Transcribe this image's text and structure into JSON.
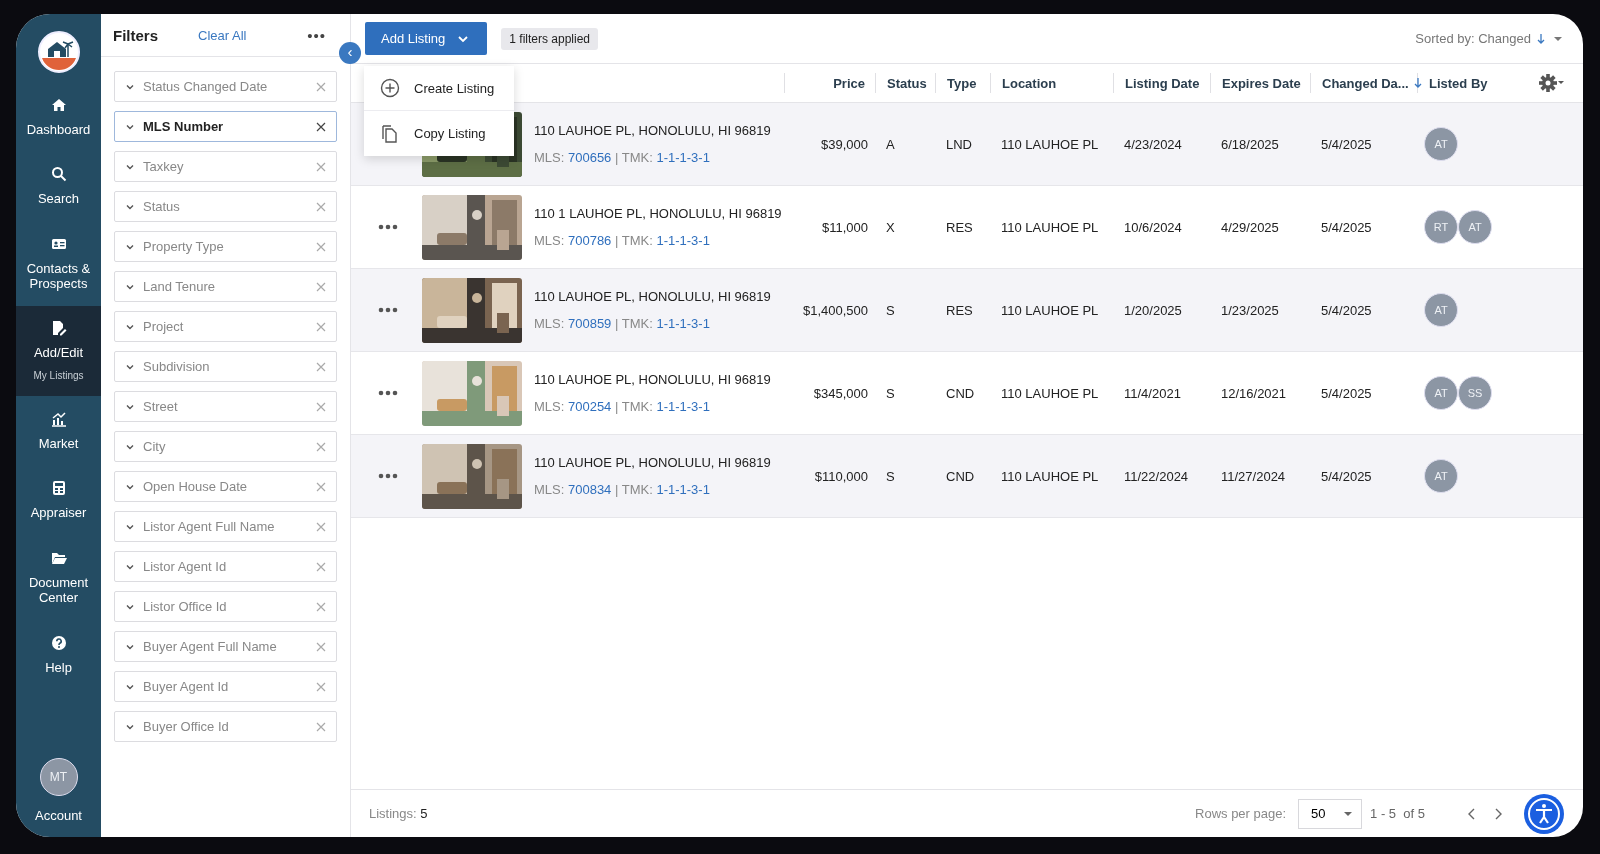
{
  "nav": {
    "items": [
      {
        "label": "Dashboard",
        "selected": false
      },
      {
        "label": "Search",
        "selected": false
      },
      {
        "label": "Contacts & Prospects",
        "selected": false
      },
      {
        "label": "Add/Edit",
        "sublabel": "My Listings",
        "selected": true
      },
      {
        "label": "Market",
        "selected": false
      },
      {
        "label": "Appraiser",
        "selected": false
      },
      {
        "label": "Document Center",
        "selected": false
      },
      {
        "label": "Help",
        "selected": false
      }
    ],
    "account": {
      "initials": "MT",
      "label": "Account"
    }
  },
  "filters": {
    "title": "Filters",
    "clear": "Clear All",
    "more": "•••",
    "collapse": "‹",
    "items": [
      {
        "label": "Status Changed Date",
        "selected": false
      },
      {
        "label": "MLS Number",
        "selected": true
      },
      {
        "label": "Taxkey",
        "selected": false
      },
      {
        "label": "Status",
        "selected": false
      },
      {
        "label": "Property Type",
        "selected": false
      },
      {
        "label": "Land Tenure",
        "selected": false
      },
      {
        "label": "Project",
        "selected": false
      },
      {
        "label": "Subdivision",
        "selected": false
      },
      {
        "label": "Street",
        "selected": false
      },
      {
        "label": "City",
        "selected": false
      },
      {
        "label": "Open House Date",
        "selected": false
      },
      {
        "label": "Listor Agent Full Name",
        "selected": false
      },
      {
        "label": "Listor Agent Id",
        "selected": false
      },
      {
        "label": "Listor Office Id",
        "selected": false
      },
      {
        "label": "Buyer Agent Full Name",
        "selected": false
      },
      {
        "label": "Buyer Agent Id",
        "selected": false
      },
      {
        "label": "Buyer Office Id",
        "selected": false
      }
    ]
  },
  "toolbar": {
    "add_button": "Add Listing",
    "filters_chip": "1 filters applied",
    "sort_label": "Sorted by: Changed",
    "menu": [
      {
        "label": "Create Listing"
      },
      {
        "label": "Copy Listing"
      }
    ]
  },
  "table": {
    "columns": [
      "Price",
      "Status",
      "Type",
      "Location",
      "Listing Date",
      "Expires Date",
      "Changed Da...",
      "Listed By"
    ],
    "rows": [
      {
        "actions": false,
        "address": "110 LAUHOE PL, HONOLULU, HI 96819",
        "mls_label": "MLS:",
        "mls": "700656",
        "tmk_label": "| TMK:",
        "tmk": "1-1-1-3-1",
        "price": "$39,000",
        "status": "A",
        "type": "LND",
        "location": "110 LAUHOE PL",
        "listing_date": "4/23/2024",
        "expires_date": "6/18/2025",
        "changed_date": "5/4/2025",
        "listed_by": [
          "AT"
        ]
      },
      {
        "actions": true,
        "address": "110 1 LAUHOE PL, HONOLULU, HI 96819",
        "mls_label": "MLS:",
        "mls": "700786",
        "tmk_label": "| TMK:",
        "tmk": "1-1-1-3-1",
        "price": "$11,000",
        "status": "X",
        "type": "RES",
        "location": "110 LAUHOE PL",
        "listing_date": "10/6/2024",
        "expires_date": "4/29/2025",
        "changed_date": "5/4/2025",
        "listed_by": [
          "RT",
          "AT"
        ]
      },
      {
        "actions": true,
        "address": "110 LAUHOE PL, HONOLULU, HI 96819",
        "mls_label": "MLS:",
        "mls": "700859",
        "tmk_label": "| TMK:",
        "tmk": "1-1-1-3-1",
        "price": "$1,400,500",
        "status": "S",
        "type": "RES",
        "location": "110 LAUHOE PL",
        "listing_date": "1/20/2025",
        "expires_date": "1/23/2025",
        "changed_date": "5/4/2025",
        "listed_by": [
          "AT"
        ]
      },
      {
        "actions": true,
        "address": "110 LAUHOE PL, HONOLULU, HI 96819",
        "mls_label": "MLS:",
        "mls": "700254",
        "tmk_label": "| TMK:",
        "tmk": "1-1-1-3-1",
        "price": "$345,000",
        "status": "S",
        "type": "CND",
        "location": "110 LAUHOE PL",
        "listing_date": "11/4/2021",
        "expires_date": "12/16/2021",
        "changed_date": "5/4/2025",
        "listed_by": [
          "AT",
          "SS"
        ]
      },
      {
        "actions": true,
        "address": "110 LAUHOE PL, HONOLULU, HI 96819",
        "mls_label": "MLS:",
        "mls": "700834",
        "tmk_label": "| TMK:",
        "tmk": "1-1-1-3-1",
        "price": "$110,000",
        "status": "S",
        "type": "CND",
        "location": "110 LAUHOE PL",
        "listing_date": "11/22/2024",
        "expires_date": "11/27/2024",
        "changed_date": "5/4/2025",
        "listed_by": [
          "AT"
        ]
      }
    ]
  },
  "footer": {
    "count_label": "Listings:",
    "count": "5",
    "rows_label": "Rows per page:",
    "rows_value": "50",
    "range": "1 - 5  of 5"
  }
}
